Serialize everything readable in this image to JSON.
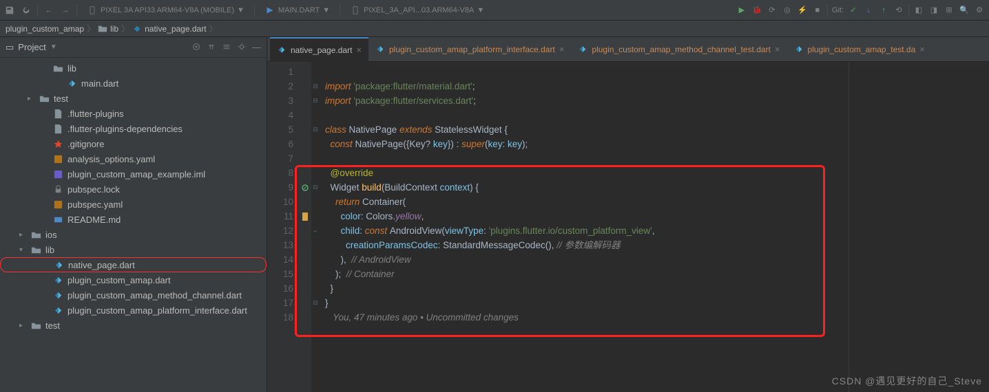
{
  "toolbar": {
    "device1": "PIXEL 3A API33 ARM64-V8A (MOBILE)",
    "runconfig": "MAIN.DART",
    "device2": "PIXEL_3A_API...03.ARM64-V8A",
    "git_label": "Git:"
  },
  "breadcrumb": {
    "items": [
      "plugin_custom_amap",
      "lib",
      "native_page.dart"
    ]
  },
  "sidebar": {
    "header": "Project",
    "tree": [
      {
        "name": "lib",
        "indent": 60,
        "icon": "folder",
        "arrow": ""
      },
      {
        "name": "main.dart",
        "indent": 80,
        "icon": "dart",
        "arrow": ""
      },
      {
        "name": "test",
        "indent": 40,
        "icon": "folder",
        "arrow": "▸"
      },
      {
        "name": ".flutter-plugins",
        "indent": 60,
        "icon": "file",
        "arrow": ""
      },
      {
        "name": ".flutter-plugins-dependencies",
        "indent": 60,
        "icon": "file",
        "arrow": ""
      },
      {
        "name": ".gitignore",
        "indent": 60,
        "icon": "git",
        "arrow": ""
      },
      {
        "name": "analysis_options.yaml",
        "indent": 60,
        "icon": "yaml",
        "arrow": ""
      },
      {
        "name": "plugin_custom_amap_example.iml",
        "indent": 60,
        "icon": "iml",
        "arrow": ""
      },
      {
        "name": "pubspec.lock",
        "indent": 60,
        "icon": "lock",
        "arrow": ""
      },
      {
        "name": "pubspec.yaml",
        "indent": 60,
        "icon": "yaml",
        "arrow": ""
      },
      {
        "name": "README.md",
        "indent": 60,
        "icon": "md",
        "arrow": ""
      },
      {
        "name": "ios",
        "indent": 28,
        "icon": "folder",
        "arrow": "▸"
      },
      {
        "name": "lib",
        "indent": 28,
        "icon": "folder",
        "arrow": "▾"
      },
      {
        "name": "native_page.dart",
        "indent": 60,
        "icon": "dart",
        "arrow": "",
        "boxed": true
      },
      {
        "name": "plugin_custom_amap.dart",
        "indent": 60,
        "icon": "dart",
        "arrow": ""
      },
      {
        "name": "plugin_custom_amap_method_channel.dart",
        "indent": 60,
        "icon": "dart",
        "arrow": ""
      },
      {
        "name": "plugin_custom_amap_platform_interface.dart",
        "indent": 60,
        "icon": "dart",
        "arrow": ""
      },
      {
        "name": "test",
        "indent": 28,
        "icon": "folder",
        "arrow": "▸"
      }
    ]
  },
  "tabs": [
    {
      "label": "native_page.dart",
      "active": true
    },
    {
      "label": "plugin_custom_amap_platform_interface.dart",
      "active": false
    },
    {
      "label": "plugin_custom_amap_method_channel_test.dart",
      "active": false
    },
    {
      "label": "plugin_custom_amap_test.da",
      "active": false
    }
  ],
  "code": {
    "blame": "You, 47 minutes ago • Uncommitted changes",
    "comment_androidview": "// AndroidView",
    "comment_container": "// Container",
    "comment_codec": "// 参数编解码器",
    "str_material": "'package:flutter/material.dart'",
    "str_services": "'package:flutter/services.dart'",
    "str_viewtype": "'plugins.flutter.io/custom_platform_view'"
  },
  "watermark": "CSDN @遇见更好的自己_Steve"
}
